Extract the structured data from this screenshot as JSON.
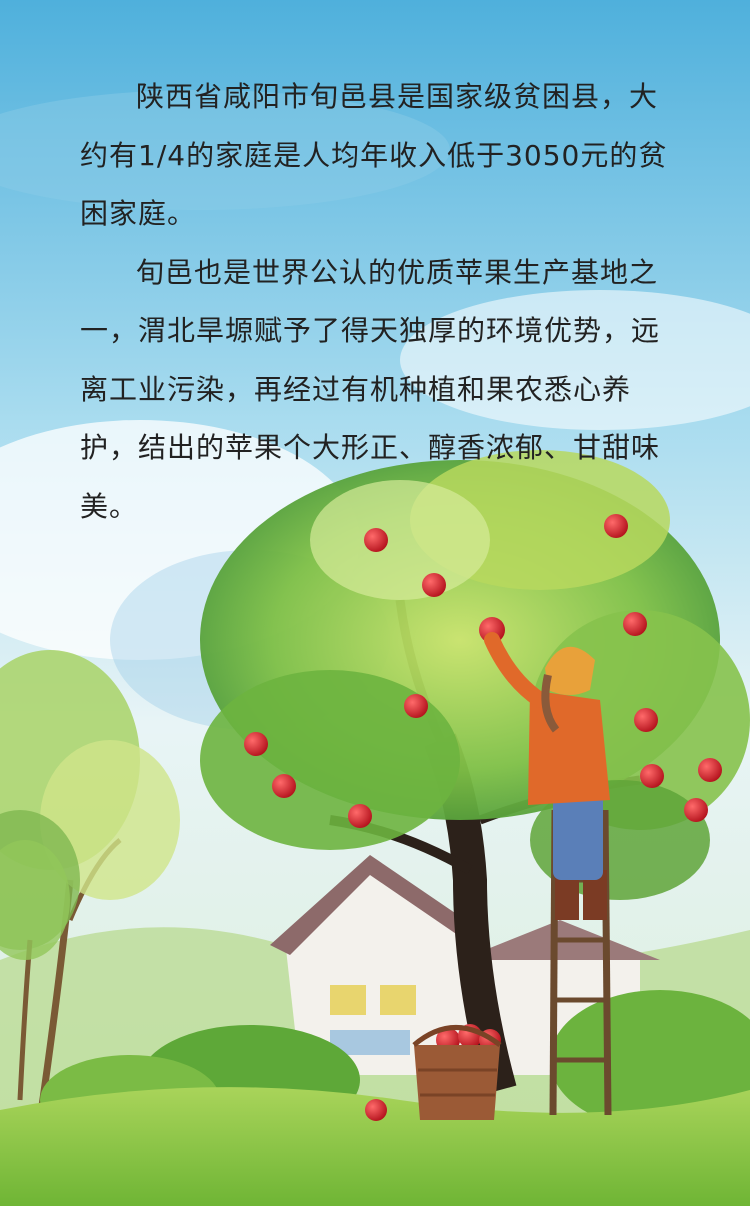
{
  "article": {
    "paragraph_1": "陕西省咸阳市旬邑县是国家级贫困县，大约有1/4的家庭是人均年收入低于3050元的贫困家庭。",
    "paragraph_2": "旬邑也是世界公认的优质苹果生产基地之一，渭北旱塬赋予了得天独厚的环境优势，远离工业污染，再经过有机种植和果农悉心养护，结出的苹果个大形正、醇香浓郁、甘甜味美。"
  },
  "colors": {
    "sky_top": "#55b4dc",
    "sky_mid": "#bfe2ef",
    "grass": "#8cc63f",
    "leaf_dark": "#4e9a2e",
    "leaf_light": "#a8d65a",
    "apple": "#d8232a",
    "jacket": "#e0692a",
    "jeans": "#5a7fb8"
  }
}
